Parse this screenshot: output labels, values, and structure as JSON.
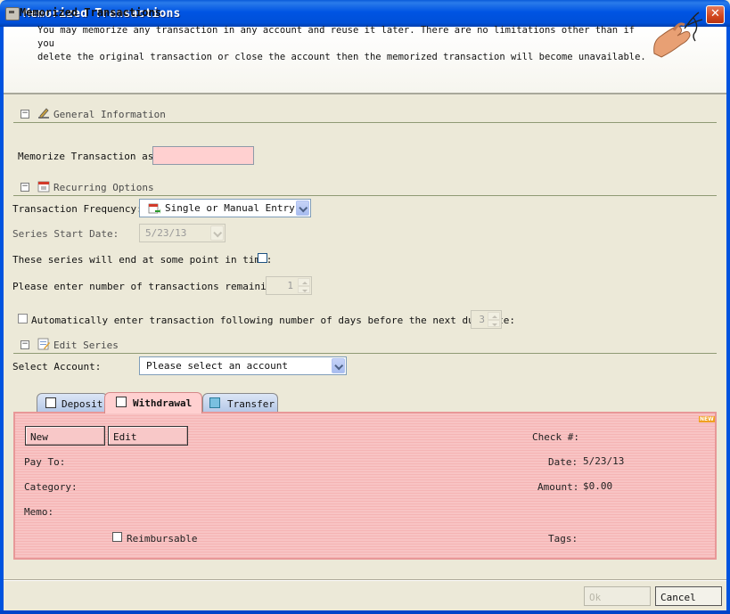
{
  "window": {
    "title": "Memorized Transactions",
    "close_glyph": "✕"
  },
  "banner": {
    "title": "Memorized Transactions",
    "description_line1": "You may memorize any transaction in any account and reuse it later. There are no limitations other than if you",
    "description_line2": "delete the original transaction or close the account then the memorized transaction will become unavailable."
  },
  "general": {
    "section_label": "General Information",
    "toggle_glyph": "−",
    "memorize_label": "Memorize Transaction as:",
    "memorize_value": ""
  },
  "recurring": {
    "section_label": "Recurring Options",
    "toggle_glyph": "−",
    "frequency_label": "Transaction Frequency:",
    "frequency_value": "Single or Manual Entry",
    "start_date_label": "Series Start Date:",
    "start_date_value": "5/23/13",
    "end_label": "These series will end at some point in time:",
    "remaining_label": "Please enter number of transactions remaining:",
    "remaining_value": "1",
    "auto_enter_label": "Automatically enter transaction following number of days before the next due date:",
    "auto_enter_days": "3"
  },
  "edit_series": {
    "section_label": "Edit Series",
    "toggle_glyph": "−",
    "account_label": "Select Account:",
    "account_value": "Please select an account"
  },
  "tabs": [
    {
      "label": "Deposit"
    },
    {
      "label": "Withdrawal"
    },
    {
      "label": "Transfer"
    }
  ],
  "panel": {
    "new_button": "New",
    "edit_button": "Edit",
    "check_label": "Check #:",
    "check_value": "",
    "pay_to_label": "Pay To:",
    "date_label": "Date:",
    "date_value": "5/23/13",
    "category_label": "Category:",
    "amount_label": "Amount:",
    "amount_value": "$0.00",
    "memo_label": "Memo:",
    "reimbursable_label": "Reimbursable",
    "tags_label": "Tags:",
    "new_badge": "NEW"
  },
  "footer": {
    "ok_button": "Ok",
    "cancel_button": "Cancel"
  },
  "colors": {
    "title_bar": "#0054e3",
    "required_field": "#ffd0d0",
    "panel_background": "#f8c4c4"
  }
}
